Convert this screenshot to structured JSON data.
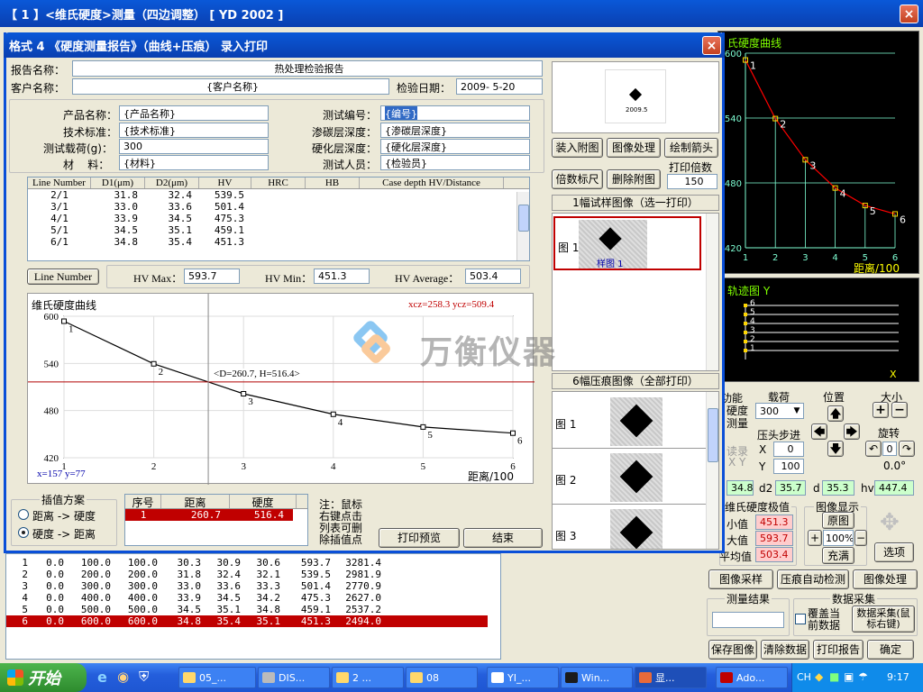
{
  "main_window": {
    "title": "【 1 】<维氏硬度>测量（四边调整） [ YD 2002 ]",
    "close": "×"
  },
  "dialog": {
    "title": "格式 4 《硬度测量报告》（曲线+压痕） 录入打印",
    "close": "×",
    "report_name_label": "报告名称：",
    "report_name": "热处理检验报告",
    "client_label": "客户名称：",
    "client": "{客户名称}",
    "date_label": "检验日期：",
    "date": "2009- 5-20",
    "fields": [
      {
        "label": "产品名称：",
        "value": "{产品名称}"
      },
      {
        "label": "技术标准：",
        "value": "{技术标准}"
      },
      {
        "label": "测试载荷(g)：",
        "value": "300"
      },
      {
        "label": "材    料：",
        "value": "{材料}"
      },
      {
        "label": "测试编号：",
        "value": "{编号}"
      },
      {
        "label": "渗碳层深度：",
        "value": "{渗碳层深度}"
      },
      {
        "label": "硬化层深度：",
        "value": "{硬化层深度}"
      },
      {
        "label": "测试人员：",
        "value": "{检验员}"
      }
    ],
    "table": {
      "headers": [
        "Line Number",
        "D1(μm)",
        "D2(μm)",
        "HV",
        "HRC",
        "HB",
        "Case depth HV/Distance"
      ],
      "rows": [
        [
          "2/1",
          "31.8",
          "32.4",
          "539.5"
        ],
        [
          "3/1",
          "33.0",
          "33.6",
          "501.4"
        ],
        [
          "4/1",
          "33.9",
          "34.5",
          "475.3"
        ],
        [
          "5/1",
          "34.5",
          "35.1",
          "459.1"
        ],
        [
          "6/1",
          "34.8",
          "35.4",
          "451.3"
        ]
      ]
    },
    "line_number_btn": "Line Number",
    "hv_max_label": "HV Max：",
    "hv_max": "593.7",
    "hv_min_label": "HV Min：",
    "hv_min": "451.3",
    "hv_avg_label": "HV Average：",
    "hv_avg": "503.4",
    "interp_title": "插值方案",
    "interp_opt1": "距离 -> 硬度",
    "interp_opt2": "硬度 -> 距离",
    "interp_table": {
      "headers": [
        "序号",
        "距离",
        "硬度"
      ],
      "row": [
        "1",
        "260.7",
        "516.4"
      ]
    },
    "note": "注：鼠标右键点击列表可删除插值点",
    "print_preview": "打印预览",
    "end": "结束",
    "attach": {
      "load": "装入附图",
      "process": "图像处理",
      "arrow": "绘制箭头",
      "scale": "倍数标尺",
      "delete": "删除附图",
      "print_mult_label": "打印倍数",
      "print_mult": "150",
      "sample_header": "1幅试样图像（选一打印）",
      "sample_row": "图 1",
      "sample_caption": "样图 1",
      "indent_header": "6幅压痕图像（全部打印）",
      "indent_rows": [
        "图 1",
        "图 2",
        "图 3"
      ],
      "mini_label": "2009.5"
    }
  },
  "chart_data": [
    {
      "type": "line",
      "title": "维氏硬度曲线",
      "xlabel": "距离/100",
      "ylabel": "",
      "x": [
        1,
        2,
        3,
        4,
        5,
        6
      ],
      "y": [
        593.7,
        539.5,
        501.4,
        475.3,
        459.1,
        451.3
      ],
      "point_labels": [
        "1",
        "2",
        "3",
        "4",
        "5",
        "6"
      ],
      "xlim": [
        1,
        6
      ],
      "ylim": [
        420,
        600
      ],
      "x_ticks": [
        "1",
        "2",
        "3",
        "4",
        "5",
        "6"
      ],
      "y_ticks": [
        "600",
        "540",
        "480",
        "420"
      ],
      "cursor_info": "xcz=258.3 ycz=509.4",
      "mouse_info": "x=157 y=77",
      "annotation": "<D=260.7, H=516.4>",
      "grid": true
    },
    {
      "type": "line",
      "title": "维氏硬度曲线",
      "xlabel": "距离/100",
      "x": [
        1,
        2,
        3,
        4,
        5,
        6
      ],
      "y": [
        593.7,
        539.5,
        501.4,
        475.3,
        459.1,
        451.3
      ],
      "x_ticks": [
        "1",
        "2",
        "3",
        "4",
        "5",
        "6"
      ],
      "y_ticks": [
        "600",
        "540",
        "480",
        "420"
      ],
      "xlim": [
        1,
        6
      ],
      "ylim": [
        420,
        600
      ],
      "colors": {
        "line": "#ff0000",
        "bg": "#000000",
        "grid": "#7fffd4"
      }
    }
  ],
  "right": {
    "curve_title": "氏硬度曲线",
    "track_title": "轨迹图 Y",
    "track_x": "X",
    "track_labels": [
      "6",
      "5",
      "4",
      "3",
      "2",
      "1"
    ],
    "func": "功能",
    "func_items": [
      "硬度",
      "测量"
    ],
    "load_label": "载荷",
    "load_value": "300",
    "pos_label": "位置",
    "size_label": "大小",
    "step_label": "压头步进",
    "x_label": "X",
    "x_value": "0",
    "y_label": "Y",
    "y_value": "100",
    "rotate_label": "旋转",
    "rotate_value": "0",
    "rotate_angle": "0.0°",
    "partial_label": "读录",
    "partial_xy": "X Y",
    "zoom": "100%",
    "fill_btn": "充满",
    "original_btn": "原图",
    "plus": "+",
    "minus": "−",
    "d1_value": "34.8",
    "d2_label": "d2",
    "d2_value": "35.7",
    "d_label": "d",
    "d_value": "35.3",
    "hv_label": "hv",
    "hv_value": "447.4",
    "extreme_title": "维氏硬度极值",
    "display_title": "图像显示",
    "min_label": "小值",
    "min_value": "451.3",
    "max_label": "大值",
    "max_value": "593.7",
    "avg_label": "平均值",
    "avg_value": "503.4",
    "options_btn": "选项",
    "capture_btn": "图像采样",
    "auto_btn": "压痕自动检测",
    "process_btn": "图像处理",
    "result_label": "测量结果",
    "data_label": "数据采集",
    "overwrite_label": "覆盖当前数据",
    "collect_btn": "数据采集(鼠标右键)",
    "save_btn": "保存图像",
    "clear_btn": "清除数据",
    "print_btn": "打印报告",
    "ok_btn": "确定"
  },
  "bottom_table": {
    "rows": [
      [
        "1",
        "0.0",
        "100.0",
        "100.0",
        "30.3",
        "30.9",
        "30.6",
        "593.7",
        "3281.4"
      ],
      [
        "2",
        "0.0",
        "200.0",
        "200.0",
        "31.8",
        "32.4",
        "32.1",
        "539.5",
        "2981.9"
      ],
      [
        "3",
        "0.0",
        "300.0",
        "300.0",
        "33.0",
        "33.6",
        "33.3",
        "501.4",
        "2770.9"
      ],
      [
        "4",
        "0.0",
        "400.0",
        "400.0",
        "33.9",
        "34.5",
        "34.2",
        "475.3",
        "2627.0"
      ],
      [
        "5",
        "0.0",
        "500.0",
        "500.0",
        "34.5",
        "35.1",
        "34.8",
        "459.1",
        "2537.2"
      ],
      [
        "6",
        "0.0",
        "600.0",
        "600.0",
        "34.8",
        "35.4",
        "35.1",
        "451.3",
        "2494.0"
      ]
    ]
  },
  "watermark": {
    "text": "万衡仪器"
  },
  "taskbar": {
    "start": "开始",
    "items": [
      "05_...",
      "DIS...",
      "2 ...",
      "08",
      "YI_...",
      "Win...",
      "显...",
      "Ado..."
    ],
    "lang": "CH",
    "clock": "9:17"
  }
}
